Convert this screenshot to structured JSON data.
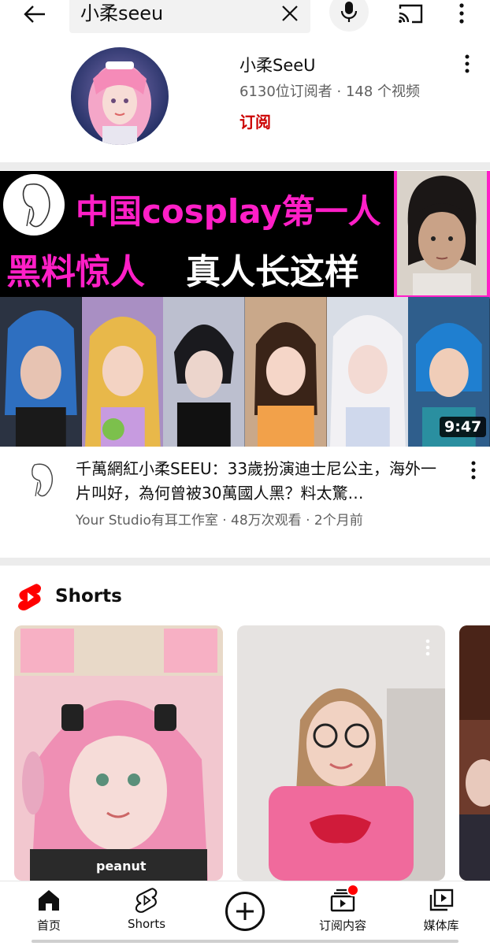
{
  "search": {
    "query": "小柔seeu"
  },
  "channel": {
    "name": "小柔SeeU",
    "meta": "6130位订阅者 · 148 个视频",
    "subscribe_label": "订阅"
  },
  "thumbnail": {
    "line1": "中国cosplay第一人",
    "line2": "黑料惊人",
    "line3": "真人长这样",
    "duration": "9:47"
  },
  "video": {
    "title": "千萬網紅小柔SEEU：33歲扮演迪士尼公主，海外一片叫好，為何曾被30萬國人黑？料太驚…",
    "meta": "Your Studio有耳工作室 · 48万次观看 · 2个月前"
  },
  "shorts": {
    "title": "Shorts",
    "card1_caption": "peanut"
  },
  "nav": {
    "items": [
      {
        "label": "首页",
        "icon": "home-icon"
      },
      {
        "label": "Shorts",
        "icon": "shorts-icon"
      },
      {
        "label": "",
        "icon": "create-icon"
      },
      {
        "label": "订阅内容",
        "icon": "subscriptions-icon"
      },
      {
        "label": "媒体库",
        "icon": "library-icon"
      }
    ]
  },
  "colors": {
    "accent_red": "#cc0000",
    "brand_red": "#ff0000",
    "banner_pink": "#ff1fc7",
    "meta_gray": "#606060"
  }
}
